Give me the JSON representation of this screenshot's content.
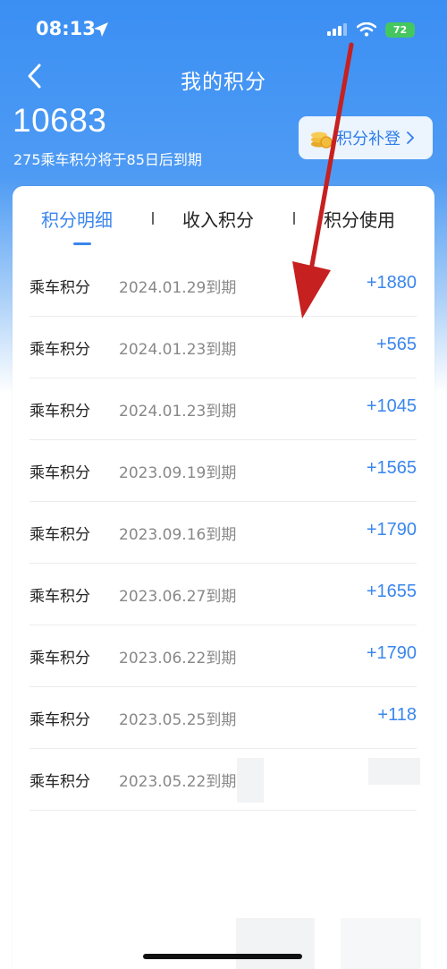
{
  "status_bar": {
    "time": "08:13",
    "battery": "72"
  },
  "nav": {
    "title": "我的积分"
  },
  "summary": {
    "total_points": "10683",
    "expire_note": "275乘车积分将于85日后到期",
    "makeup_label": "积分补登"
  },
  "tabs": [
    {
      "label": "积分明细",
      "active": true
    },
    {
      "label": "收入积分",
      "active": false
    },
    {
      "label": "积分使用",
      "active": false
    }
  ],
  "records": [
    {
      "type": "乘车积分",
      "date": "2024.01.29到期",
      "points": "+1880"
    },
    {
      "type": "乘车积分",
      "date": "2024.01.23到期",
      "points": "+565"
    },
    {
      "type": "乘车积分",
      "date": "2024.01.23到期",
      "points": "+1045"
    },
    {
      "type": "乘车积分",
      "date": "2023.09.19到期",
      "points": "+1565"
    },
    {
      "type": "乘车积分",
      "date": "2023.09.16到期",
      "points": "+1790"
    },
    {
      "type": "乘车积分",
      "date": "2023.06.27到期",
      "points": "+1655"
    },
    {
      "type": "乘车积分",
      "date": "2023.06.22到期",
      "points": "+1790"
    },
    {
      "type": "乘车积分",
      "date": "2023.05.25到期",
      "points": "+118"
    },
    {
      "type": "乘车积分",
      "date": "2023.05.22到期",
      "points": ""
    }
  ],
  "colors": {
    "accent": "#3a86ee",
    "header_blue": "#3b8ff3",
    "annotation_arrow": "#c62020",
    "battery_green": "#45c760"
  },
  "icons": [
    "location-arrow-icon",
    "signal-icon",
    "wifi-icon",
    "back-chevron-icon",
    "coin-stack-icon",
    "chevron-right-icon"
  ]
}
